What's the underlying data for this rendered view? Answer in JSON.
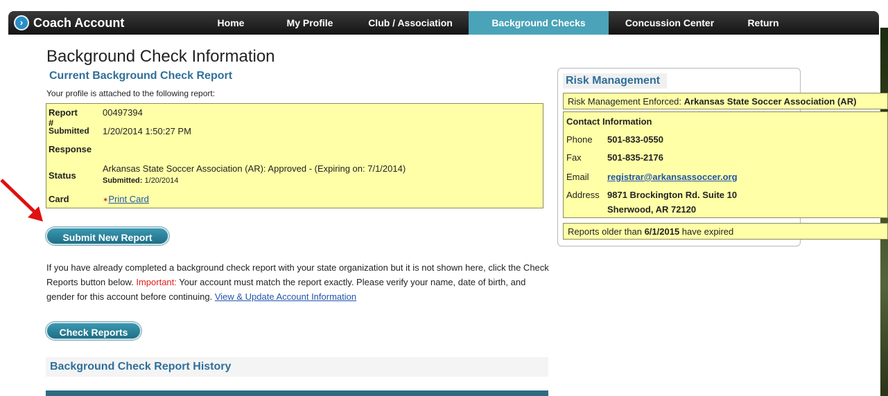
{
  "nav": {
    "brand": "Coach Account",
    "items": [
      {
        "label": "Home"
      },
      {
        "label": "My Profile"
      },
      {
        "label": "Club / Association"
      },
      {
        "label": "Background Checks"
      },
      {
        "label": "Concussion Center"
      },
      {
        "label": "Return"
      }
    ],
    "active_item": "Background Checks"
  },
  "page": {
    "title": "Background Check Information",
    "current_title": "Current Background Check Report",
    "intro": "Your profile is attached to the following report:"
  },
  "report": {
    "number_label": "Report #",
    "number": "00497394",
    "submitted_label": "Submitted",
    "submitted": "1/20/2014 1:50:27 PM",
    "response_label": "Response",
    "status_label": "Status",
    "status": "Arkansas State Soccer Association (AR): Approved - (Expiring on: 7/1/2014)",
    "status_sub_label": "Submitted:",
    "status_sub_value": "1/20/2014",
    "card_label": "Card",
    "card_link": "Print Card"
  },
  "buttons": {
    "submit_new": "Submit New Report",
    "check_reports": "Check Reports"
  },
  "info": {
    "text1": "If you have already completed a background check report with your state organization but it is not shown here, click the Check Reports button below. ",
    "important": "Important:",
    "text2": " Your account must match the report exactly. Please verify your name, date of birth, and gender for this account before continuing. ",
    "link": "View & Update Account Information"
  },
  "history": {
    "title": "Background Check Report History"
  },
  "risk": {
    "title": "Risk Management",
    "enforced_label": "Risk Management Enforced: ",
    "enforced_value": "Arkansas State Soccer Association (AR)",
    "contact_title": "Contact Information",
    "phone_label": "Phone",
    "phone": "501-833-0550",
    "fax_label": "Fax",
    "fax": "501-835-2176",
    "email_label": "Email",
    "email": "registrar@arkansassoccer.org",
    "address_label": "Address",
    "address_line1": "9871 Brockington Rd. Suite 10",
    "address_line2": "Sherwood, AR 72120",
    "expired_prefix": "Reports older than ",
    "expired_date": "6/1/2015",
    "expired_suffix": " have expired"
  },
  "colors": {
    "nav_active": "#4aa3b8",
    "report_bg": "#ffffa8",
    "section_title": "#2f6f9a",
    "button": "#1f6e86",
    "important": "#e11b1b",
    "annotation_arrow": "#e01010"
  },
  "icons": {
    "brand": "chevron-right-circle-icon",
    "card": "pdf-icon",
    "annotation": "red-arrow-icon"
  }
}
